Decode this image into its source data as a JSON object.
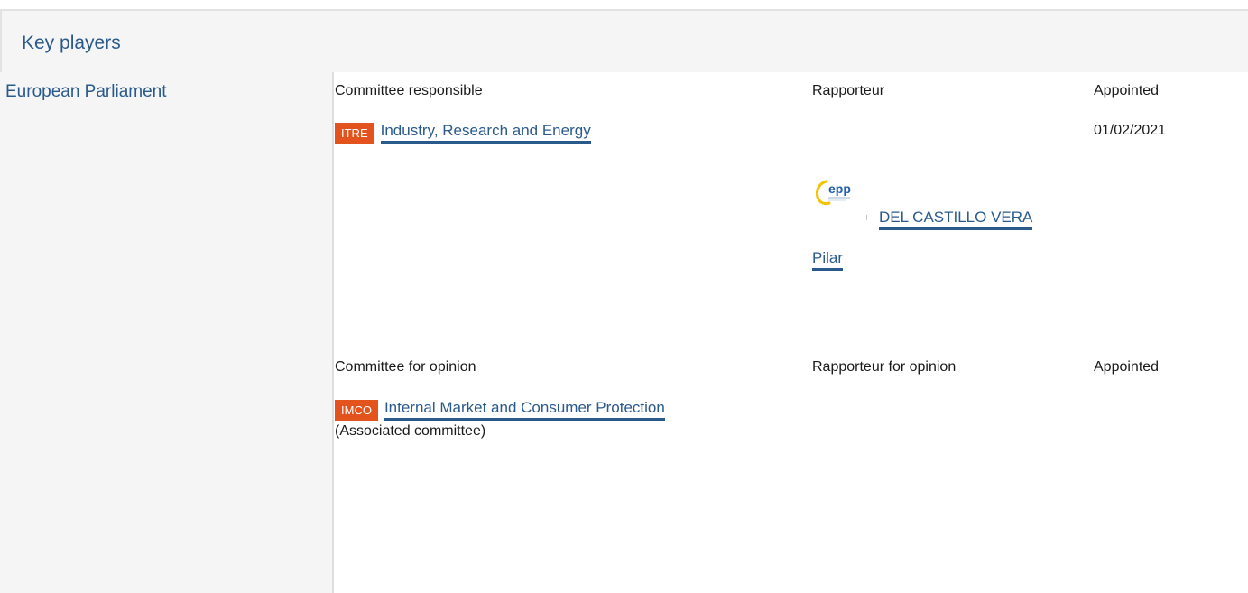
{
  "section": {
    "title": "Key players"
  },
  "institution": "European Parliament",
  "responsible": {
    "heading": "Committee responsible",
    "rapporteur_heading": "Rapporteur",
    "appointed_heading": "Appointed",
    "committee": {
      "code": "ITRE",
      "name": "Industry, Research and Energy"
    },
    "appointed_date": "01/02/2021",
    "rapporteur": {
      "group_logo_text": "epp",
      "name_line1": "DEL CASTILLO VERA",
      "name_line2": "Pilar"
    }
  },
  "opinion": {
    "heading": "Committee for opinion",
    "rapporteur_heading": "Rapporteur for opinion",
    "appointed_heading": "Appointed",
    "committee": {
      "code": "IMCO",
      "name": "Internal Market and Consumer Protection"
    },
    "note": "(Associated committee)"
  },
  "colors": {
    "link": "#2a5a8c",
    "badge": "#e2531d",
    "panel_bg": "#f5f5f5",
    "epp_blue": "#1f5fa8",
    "epp_yellow": "#f3c200"
  }
}
